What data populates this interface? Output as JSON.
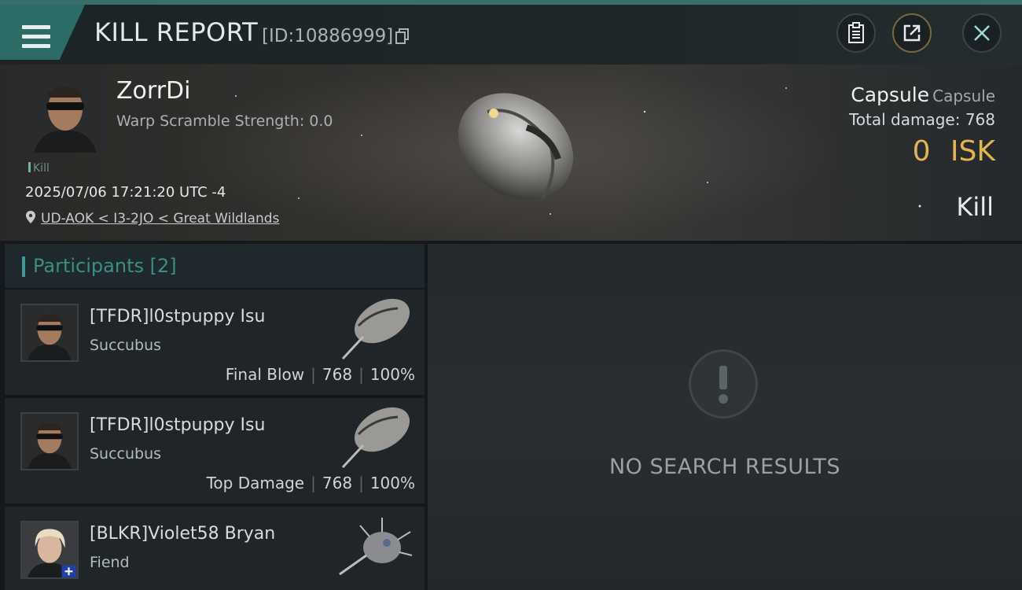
{
  "header": {
    "title": "KILL REPORT",
    "report_id": "[ID:10886999]",
    "buttons": {
      "copy": "copy-icon",
      "clipboard": "clipboard-icon",
      "share": "share-icon",
      "close": "close-icon"
    }
  },
  "victim": {
    "name": "ZorrDi",
    "warp_scramble": "Warp Scramble Strength: 0.0",
    "tag": "Kill",
    "datetime": "2025/07/06 17:21:20 UTC -4",
    "location": "UD-AOK < I3-2JO < Great Wildlands",
    "ship_name": "Capsule",
    "ship_class": "Capsule",
    "total_damage": "Total damage:  768",
    "isk_value": "0",
    "isk_unit": "ISK",
    "result": "Kill"
  },
  "participants": {
    "title": "Participants",
    "count": "[2]",
    "rows": [
      {
        "name": "[TFDR]l0stpuppy Isu",
        "ship": "Succubus",
        "role": "Final Blow",
        "damage": "768",
        "percent": "100%"
      },
      {
        "name": "[TFDR]l0stpuppy Isu",
        "ship": "Succubus",
        "role": "Top Damage",
        "damage": "768",
        "percent": "100%"
      },
      {
        "name": "[BLKR]Violet58 Bryan",
        "ship": "Fiend",
        "role": "",
        "damage": "",
        "percent": ""
      }
    ]
  },
  "results": {
    "empty_text": "NO SEARCH RESULTS"
  },
  "colors": {
    "accent": "#3b9b94",
    "isk": "#e2b64f"
  }
}
